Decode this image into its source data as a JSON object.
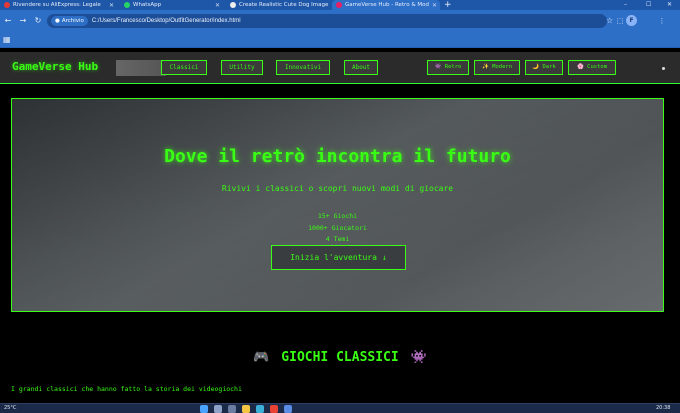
{
  "browser": {
    "tabs": [
      {
        "title": "Rivendere su AliExpress: Legale",
        "color": "#e53935"
      },
      {
        "title": "WhatsApp",
        "color": "#25d366"
      },
      {
        "title": "Create Realistic Cute Dog Image",
        "color": "#111111"
      },
      {
        "title": "GameVerse Hub - Retro & Mod",
        "color": "#e91e63"
      }
    ],
    "new_tab_label": "+",
    "window_controls": [
      "–",
      "☐",
      "✕"
    ],
    "site_chip": "Archivio",
    "url": "C:/Users/Francesco/Desktop/OutfitGenerator/index.html",
    "profile_initial": "F"
  },
  "site": {
    "logo": "GameVerse Hub",
    "nav": [
      "Classici",
      "Utility",
      "Innovativi",
      "About"
    ],
    "themes": [
      {
        "icon": "👾",
        "label": "Retro"
      },
      {
        "icon": "✨",
        "label": "Modern"
      },
      {
        "icon": "🌙",
        "label": "Dark"
      },
      {
        "icon": "🌸",
        "label": "Custom"
      }
    ]
  },
  "hero": {
    "title": "Dove il retrò incontra il futuro",
    "subtitle": "Rivivi i classici o scopri nuovi modi di giocare",
    "stats": [
      "15+ Giochi",
      "1000+ Giocatori",
      "4 Temi"
    ],
    "cta_label": "Inizia l'avventura",
    "cta_icon": "↓"
  },
  "classics": {
    "title": "GIOCHI CLASSICI",
    "icon_left": "🎮",
    "icon_right": "👾",
    "subtitle": "I grandi classici che hanno fatto la storia dei videogiochi"
  },
  "taskbar": {
    "weather": "25°C",
    "clock": "20:38"
  },
  "colors": {
    "accent": "#39ff14",
    "browser_blue": "#2d6ec7"
  }
}
